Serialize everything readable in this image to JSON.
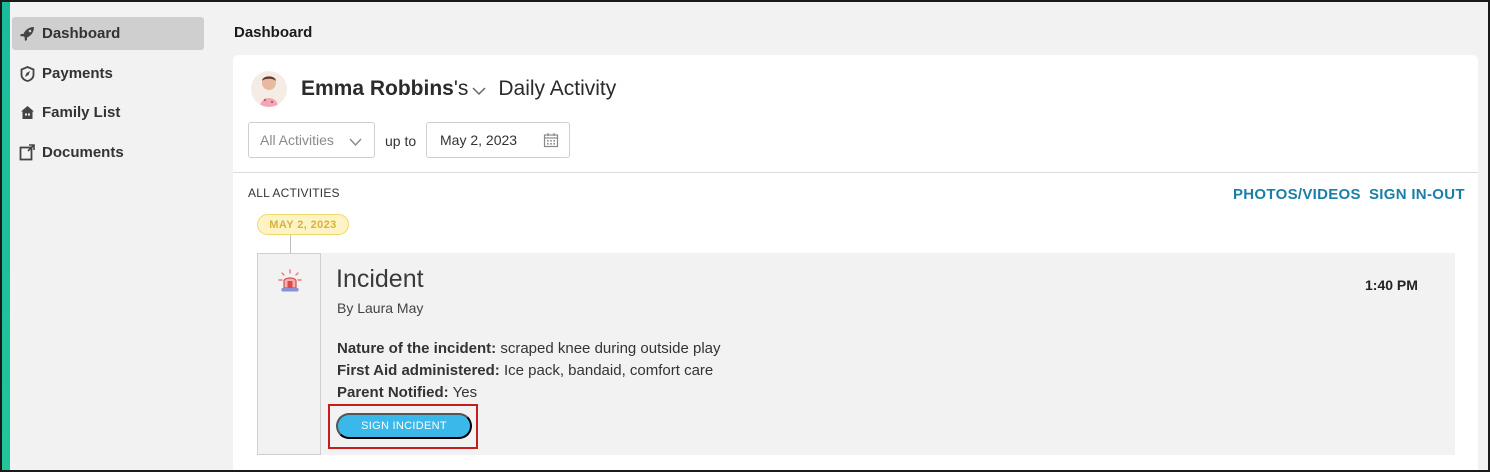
{
  "sidebar": {
    "items": [
      {
        "label": "Dashboard",
        "icon": "rocket-icon",
        "active": true
      },
      {
        "label": "Payments",
        "icon": "compass-badge-icon",
        "active": false
      },
      {
        "label": "Family List",
        "icon": "house-icon",
        "active": false
      },
      {
        "label": "Documents",
        "icon": "document-export-icon",
        "active": false
      }
    ]
  },
  "header": {
    "title": "Dashboard"
  },
  "child": {
    "name": "Emma Robbins",
    "possessive": "'s",
    "activity_title": "Daily Activity"
  },
  "filters": {
    "activity_select": "All Activities",
    "up_to_label": "up to",
    "date_value": "May 2, 2023"
  },
  "feed": {
    "section_label": "ALL ACTIVITIES",
    "photos_link": "PHOTOS/VIDEOS",
    "signin_link": "SIGN IN-OUT",
    "date_badge": "MAY 2, 2023"
  },
  "incident": {
    "title": "Incident",
    "by": "By Laura May",
    "time": "1:40 PM",
    "details": [
      {
        "label": "Nature of the incident:",
        "value": "scraped knee during outside play"
      },
      {
        "label": "First Aid administered:",
        "value": "Ice pack, bandaid, comfort care"
      },
      {
        "label": "Parent Notified:",
        "value": "Yes"
      }
    ],
    "sign_button": "SIGN INCIDENT"
  },
  "colors": {
    "accent": "#1abc9c",
    "link": "#1a7fa8",
    "button": "#3ab8ea",
    "highlight": "#c41e1e",
    "badge_bg": "#fdf3c4"
  }
}
